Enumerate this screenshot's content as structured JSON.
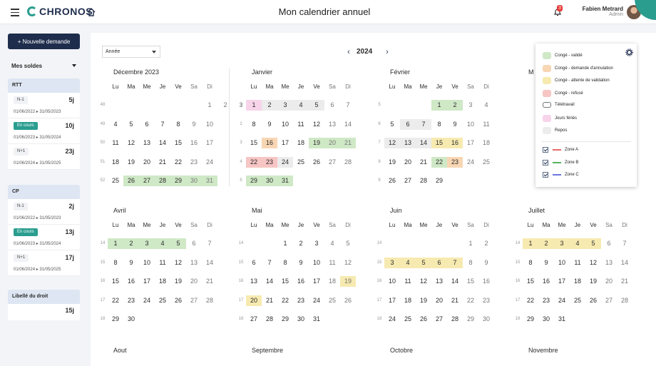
{
  "header": {
    "app_name": "CHRONOS",
    "page_title": "Mon calendrier annuel",
    "notification_count": "3",
    "user_name": "Fabien Metrard",
    "user_role": "Admin"
  },
  "sidebar": {
    "new_request_label": "+ Nouvelle demande",
    "balances_label": "Mes soldes",
    "groups": [
      {
        "title": "RTT",
        "rows": [
          {
            "tag": "N-1",
            "value": "5j",
            "start": "01/06/2022",
            "end": "31/05/2023"
          },
          {
            "tag": "En cours",
            "value": "10j",
            "start": "01/06/2023",
            "end": "31/05/2024"
          },
          {
            "tag": "N+1",
            "value": "23j",
            "start": "01/06/2024",
            "end": "31/05/2025"
          }
        ]
      },
      {
        "title": "CP",
        "rows": [
          {
            "tag": "N-1",
            "value": "2j",
            "start": "01/06/2022",
            "end": "31/05/2023"
          },
          {
            "tag": "En cours",
            "value": "13j",
            "start": "01/06/2023",
            "end": "31/05/2024"
          },
          {
            "tag": "N+1",
            "value": "17j",
            "start": "01/06/2024",
            "end": "31/05/2025"
          }
        ]
      },
      {
        "title": "Libellé du droit",
        "rows": [
          {
            "value": "15j"
          }
        ]
      }
    ]
  },
  "toolbar": {
    "period_value": "Année",
    "year": "2024"
  },
  "calendar": {
    "weekday_headers": [
      "Lu",
      "Ma",
      "Me",
      "Je",
      "Ve",
      "Sa",
      "Di"
    ],
    "months": [
      {
        "name": "Décembre 2023",
        "weeks": [
          [
            "48",
            [
              "",
              "",
              "",
              "1",
              "2",
              "3"
            ]
          ],
          [
            "49",
            [
              "4",
              "5",
              "6",
              "7",
              "8",
              "9",
              "10"
            ]
          ],
          [
            "50",
            [
              "11",
              "12",
              "13",
              "14",
              "15",
              "16",
              "17"
            ]
          ],
          [
            "51",
            [
              "18",
              "19",
              "20",
              "21",
              "22",
              "23",
              "24"
            ]
          ],
          [
            "52",
            [
              "25",
              "26",
              "27",
              "28",
              "29",
              "30",
              "31"
            ]
          ]
        ],
        "offset": 3
      },
      {
        "name": "Janvier",
        "weeks": [
          [
            "1",
            [
              "1",
              "2",
              "3",
              "4",
              "5",
              "6",
              "7"
            ]
          ],
          [
            "2",
            [
              "8",
              "9",
              "10",
              "11",
              "12",
              "13",
              "14"
            ]
          ],
          [
            "3",
            [
              "15",
              "16",
              "17",
              "18",
              "19",
              "20",
              "21"
            ]
          ],
          [
            "4",
            [
              "22",
              "23",
              "24",
              "25",
              "26",
              "27",
              "28"
            ]
          ],
          [
            "5",
            [
              "29",
              "30",
              "31"
            ]
          ]
        ],
        "offset": 0
      },
      {
        "name": "Février",
        "weeks": [
          [
            "5",
            [
              "1",
              "2",
              "3",
              "4"
            ]
          ],
          [
            "6",
            [
              "5",
              "6",
              "7",
              "8",
              "9",
              "10",
              "11"
            ]
          ],
          [
            "7",
            [
              "12",
              "13",
              "14",
              "15",
              "16",
              "17",
              "18"
            ]
          ],
          [
            "8",
            [
              "19",
              "20",
              "21",
              "22",
              "23",
              "24",
              "25"
            ]
          ],
          [
            "9",
            [
              "26",
              "27",
              "28",
              "29"
            ]
          ]
        ],
        "offset": 3
      },
      {
        "name": "Avril",
        "weeks": [
          [
            "14",
            [
              "1",
              "2",
              "3",
              "4",
              "5",
              "6",
              "7"
            ]
          ],
          [
            "15",
            [
              "8",
              "9",
              "10",
              "11",
              "12",
              "13",
              "14"
            ]
          ],
          [
            "16",
            [
              "15",
              "16",
              "17",
              "18",
              "19",
              "20",
              "21"
            ]
          ],
          [
            "17",
            [
              "22",
              "23",
              "24",
              "25",
              "26",
              "27",
              "28"
            ]
          ],
          [
            "18",
            [
              "29",
              "30"
            ]
          ]
        ],
        "offset": 0
      },
      {
        "name": "Mai",
        "weeks": [
          [
            "14",
            [
              "1",
              "2",
              "3",
              "4",
              "5"
            ]
          ],
          [
            "15",
            [
              "6",
              "7",
              "8",
              "9",
              "10",
              "11",
              "12"
            ]
          ],
          [
            "16",
            [
              "13",
              "14",
              "15",
              "16",
              "17",
              "18",
              "19"
            ]
          ],
          [
            "17",
            [
              "20",
              "21",
              "22",
              "23",
              "24",
              "25",
              "26"
            ]
          ],
          [
            "18",
            [
              "27",
              "28",
              "29",
              "30",
              "31"
            ]
          ]
        ],
        "offset": 2
      },
      {
        "name": "Juin",
        "weeks": [
          [
            "14",
            [
              "1",
              "2"
            ]
          ],
          [
            "15",
            [
              "3",
              "4",
              "5",
              "6",
              "7",
              "8",
              "9"
            ]
          ],
          [
            "16",
            [
              "10",
              "11",
              "12",
              "13",
              "14",
              "15",
              "16"
            ]
          ],
          [
            "17",
            [
              "17",
              "18",
              "19",
              "20",
              "21",
              "22",
              "23"
            ]
          ],
          [
            "18",
            [
              "24",
              "25",
              "26",
              "27",
              "28",
              "29",
              "30"
            ]
          ]
        ],
        "offset": 5
      },
      {
        "name": "Juillet",
        "weeks": [
          [
            "14",
            [
              "1",
              "2",
              "3",
              "4",
              "5",
              "6",
              "7"
            ]
          ],
          [
            "15",
            [
              "8",
              "9",
              "10",
              "11",
              "12",
              "13",
              "14"
            ]
          ],
          [
            "16",
            [
              "15",
              "16",
              "17",
              "18",
              "19",
              "20",
              "21"
            ]
          ],
          [
            "17",
            [
              "22",
              "23",
              "24",
              "25",
              "26",
              "27",
              "28"
            ]
          ],
          [
            "18",
            [
              "29",
              "30",
              "31"
            ]
          ]
        ],
        "offset": 0
      }
    ],
    "next_row_months": [
      "Aout",
      "Septembre",
      "Octobre",
      "Novembre"
    ],
    "partial_month_initial": "M",
    "legend": {
      "items": [
        "Congé - validé",
        "Congé - demande d'annulation",
        "Congé - attente de validation",
        "Congé - refusé",
        "Télétravail",
        "Jours fériés",
        "Repos"
      ],
      "zones": [
        "Zone A",
        "Zone B",
        "Zone C"
      ],
      "colors": {
        "valide": "#cfe8c6",
        "annulation": "#f8d6b3",
        "attente": "#f7eab0",
        "refuse": "#f6c5c4",
        "ferie": "#f7d4ea",
        "repos": "#ececec",
        "zoneA": "#e86a6a",
        "zoneB": "#56b35a",
        "zoneC": "#6b76e0"
      }
    }
  }
}
